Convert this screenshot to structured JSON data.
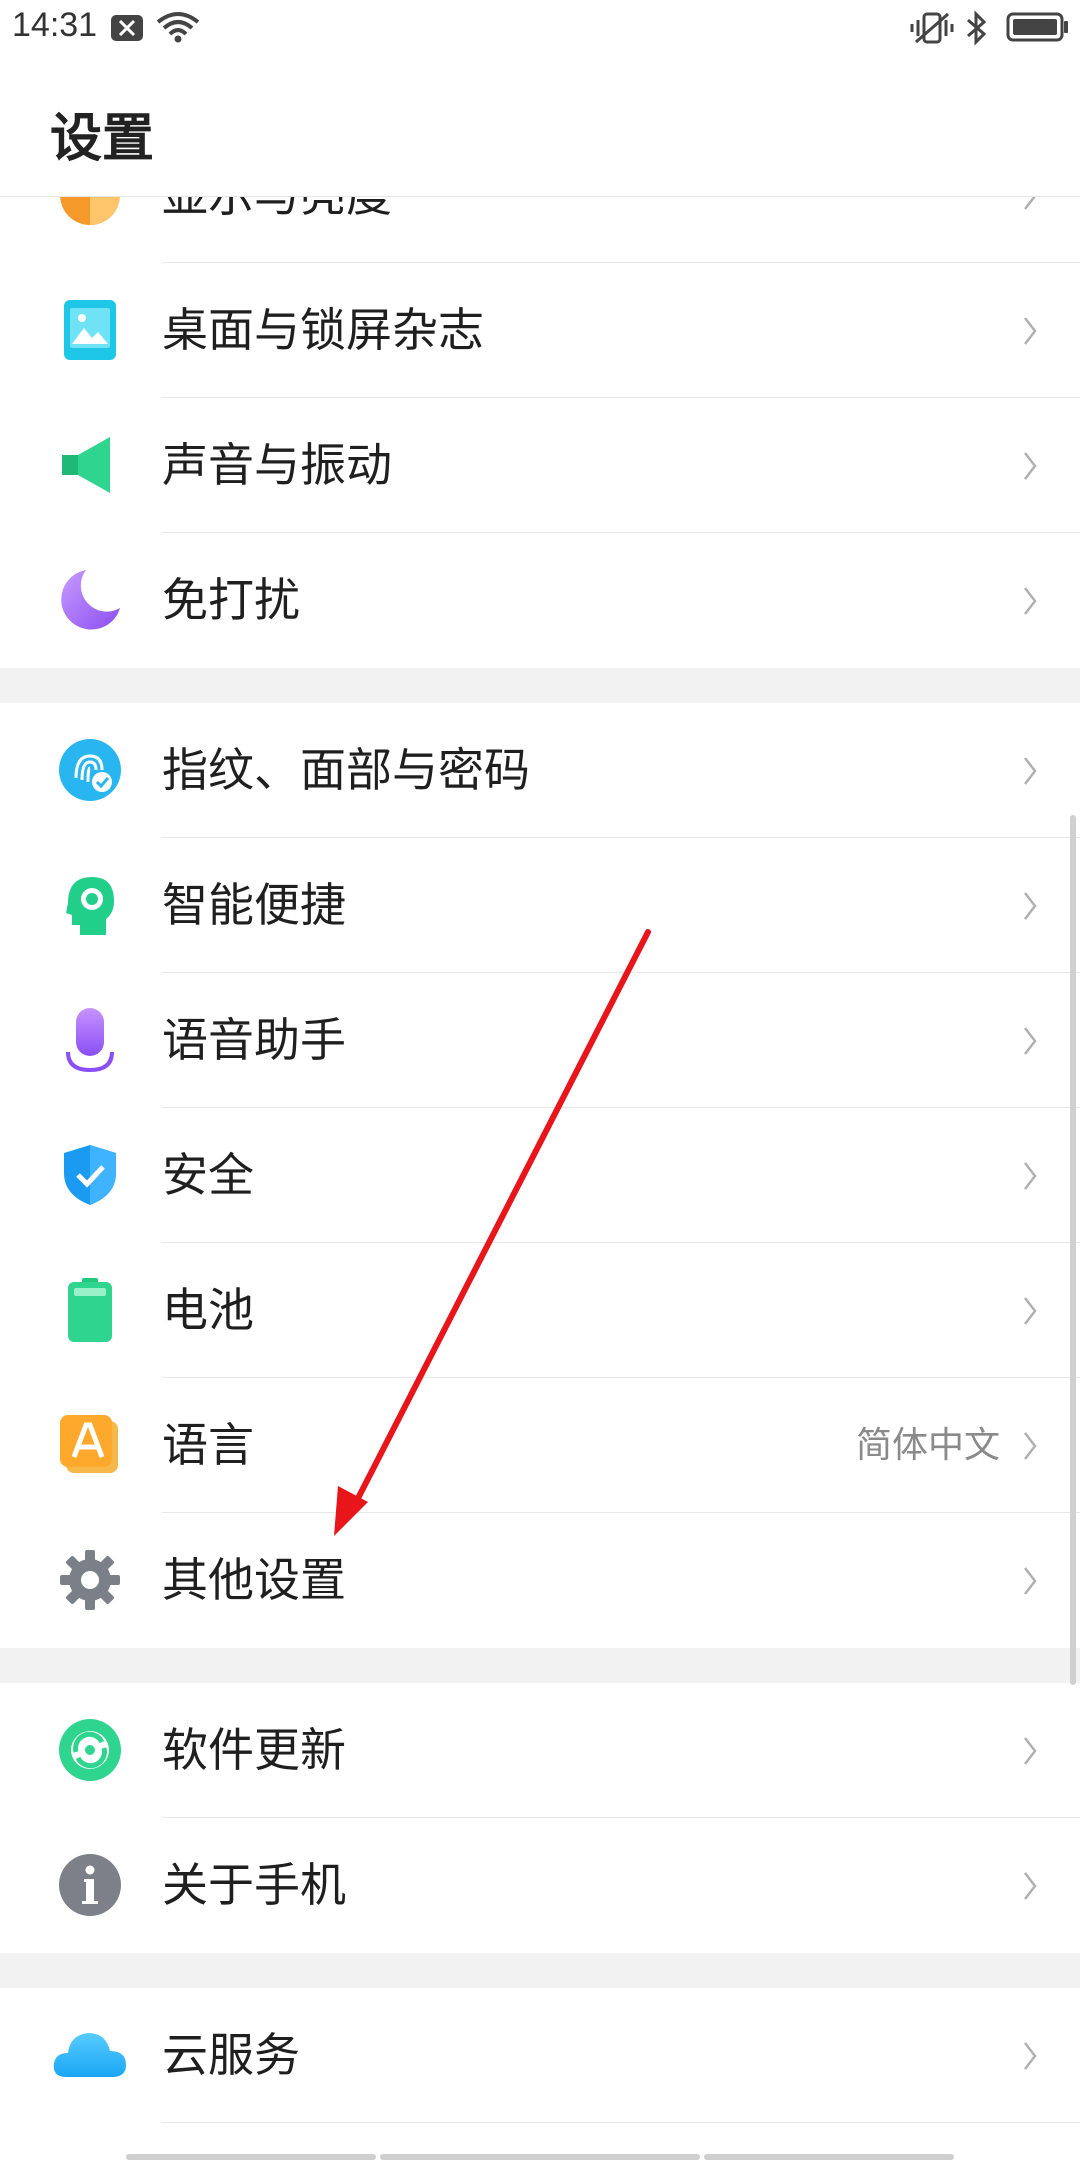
{
  "status_bar": {
    "time": "14:31"
  },
  "header": {
    "title": "设置"
  },
  "sections": [
    {
      "items": [
        {
          "id": "display",
          "label": "显示与亮度",
          "icon": "display-brightness-icon"
        },
        {
          "id": "wallpaper",
          "label": "桌面与锁屏杂志",
          "icon": "wallpaper-icon"
        },
        {
          "id": "sound",
          "label": "声音与振动",
          "icon": "speaker-icon"
        },
        {
          "id": "dnd",
          "label": "免打扰",
          "icon": "moon-icon"
        }
      ]
    },
    {
      "items": [
        {
          "id": "fingerprint",
          "label": "指纹、面部与密码",
          "icon": "fingerprint-face-icon"
        },
        {
          "id": "smart",
          "label": "智能便捷",
          "icon": "smart-head-icon"
        },
        {
          "id": "voice",
          "label": "语音助手",
          "icon": "microphone-icon"
        },
        {
          "id": "security",
          "label": "安全",
          "icon": "shield-check-icon"
        },
        {
          "id": "battery",
          "label": "电池",
          "icon": "battery-icon"
        },
        {
          "id": "language",
          "label": "语言",
          "value": "简体中文",
          "icon": "language-a-icon"
        },
        {
          "id": "other",
          "label": "其他设置",
          "icon": "gear-icon"
        }
      ]
    },
    {
      "items": [
        {
          "id": "update",
          "label": "软件更新",
          "icon": "sync-icon"
        },
        {
          "id": "about",
          "label": "关于手机",
          "icon": "info-icon"
        }
      ]
    },
    {
      "items": [
        {
          "id": "cloud",
          "label": "云服务",
          "icon": "cloud-icon"
        }
      ]
    }
  ],
  "colors": {
    "accent_red_arrow": "#e8151b",
    "section_gap": "#f2f2f2",
    "chevron": "#b0b0b0"
  }
}
